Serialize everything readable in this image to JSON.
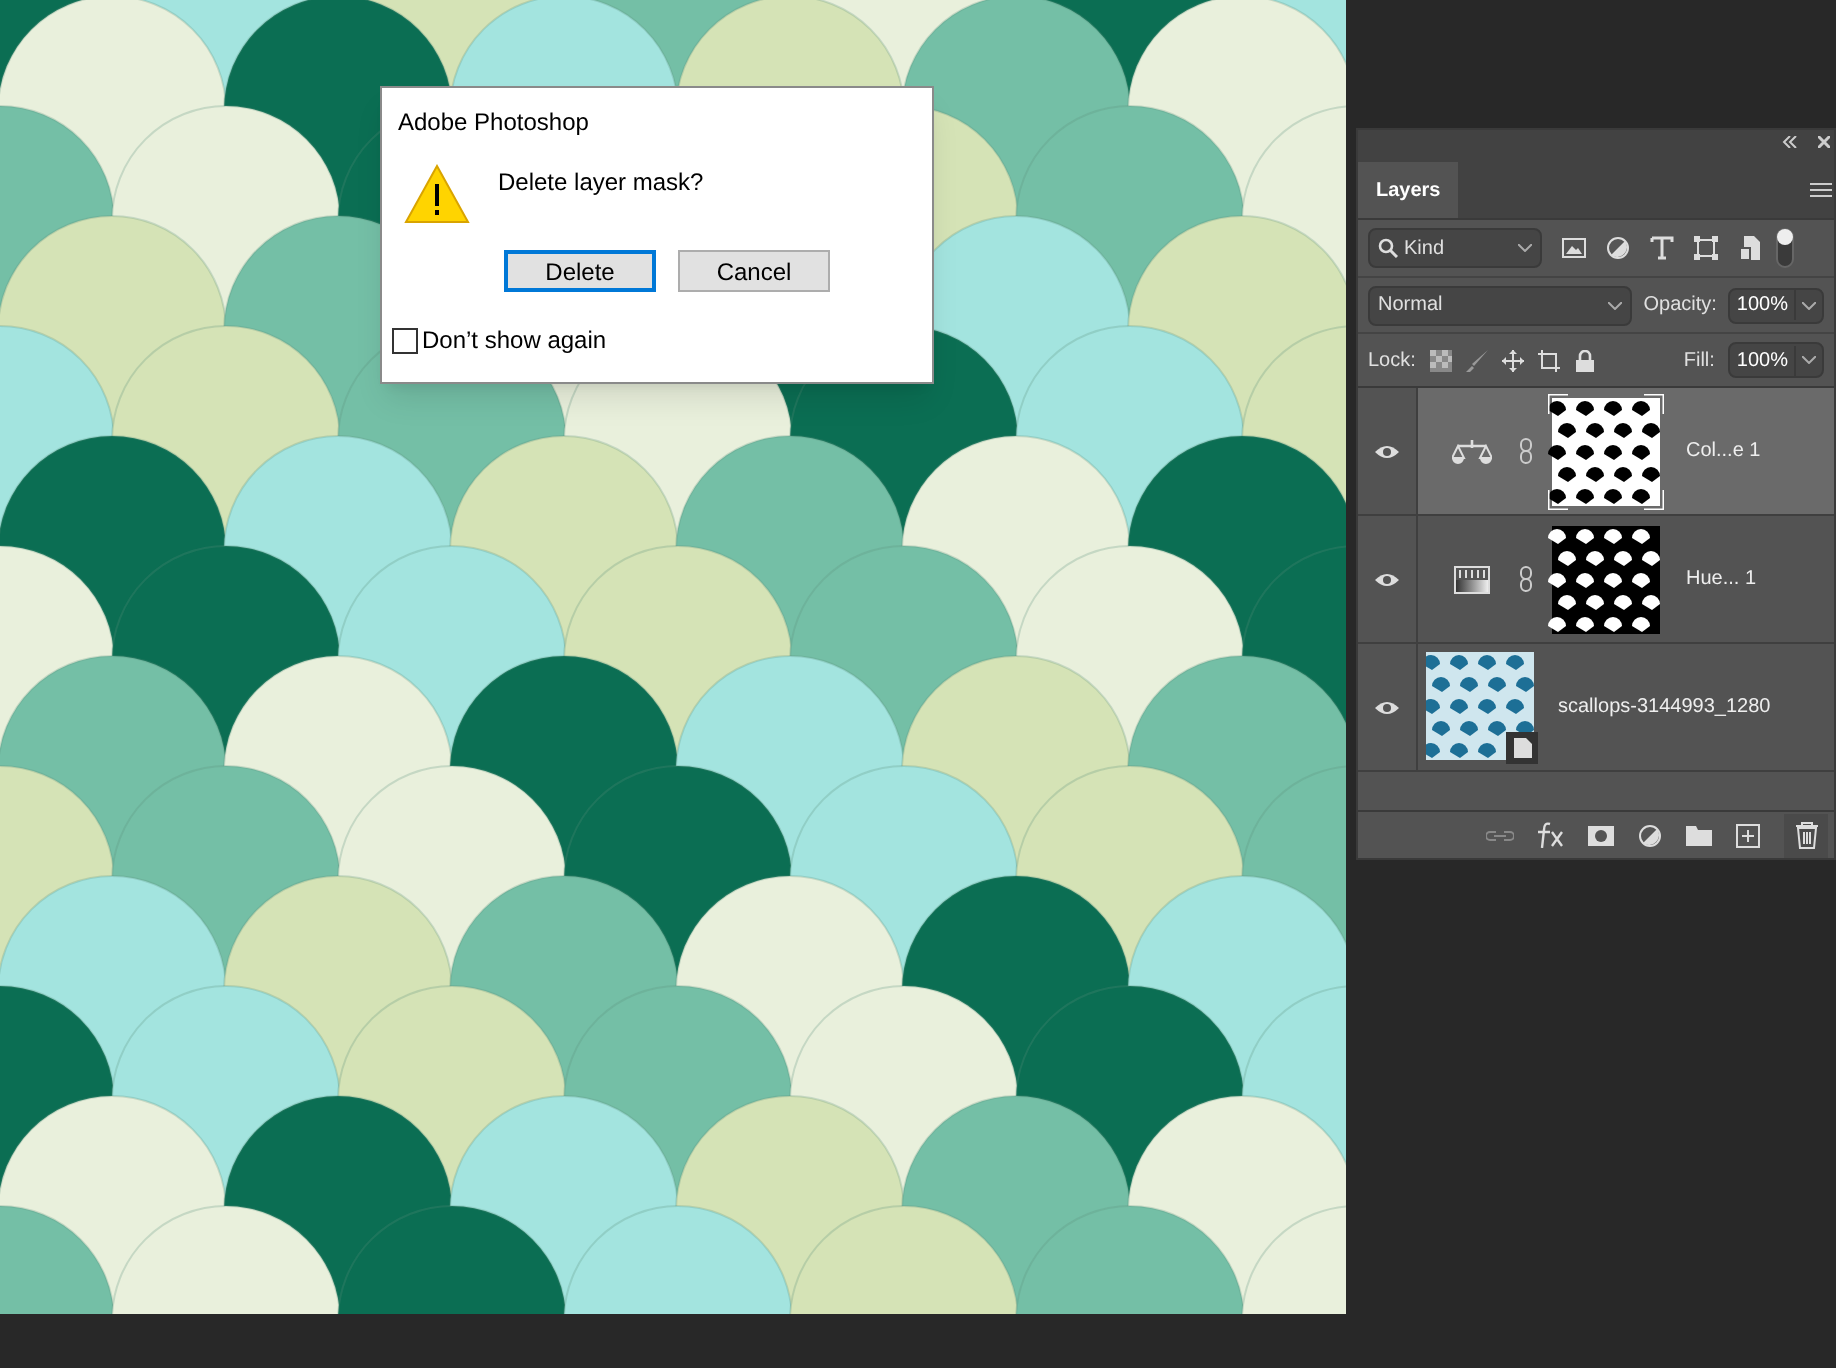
{
  "dialog": {
    "title": "Adobe Photoshop",
    "message": "Delete layer mask?",
    "buttons": [
      {
        "label": "Delete",
        "focused": true
      },
      {
        "label": "Cancel",
        "focused": false
      }
    ],
    "checkbox": {
      "label": "Don’t show again",
      "checked": false
    }
  },
  "layers_panel": {
    "tab": {
      "label": "Layers",
      "selected": true
    },
    "filter": {
      "value": "Kind"
    },
    "blend_mode": {
      "value": "Normal"
    },
    "opacity": {
      "label": "Opacity:",
      "value": "100%"
    },
    "lock": {
      "label": "Lock:"
    },
    "fill": {
      "label": "Fill:",
      "value": "100%"
    },
    "layers": [
      {
        "kind": "color-balance",
        "name": "Col...e 1",
        "visible": true,
        "selected": true
      },
      {
        "kind": "hue-saturation",
        "name": "Hue... 1",
        "visible": true,
        "selected": false
      },
      {
        "kind": "smart-object",
        "name": "scallops-3144993_1280",
        "visible": true,
        "selected": false
      }
    ]
  }
}
